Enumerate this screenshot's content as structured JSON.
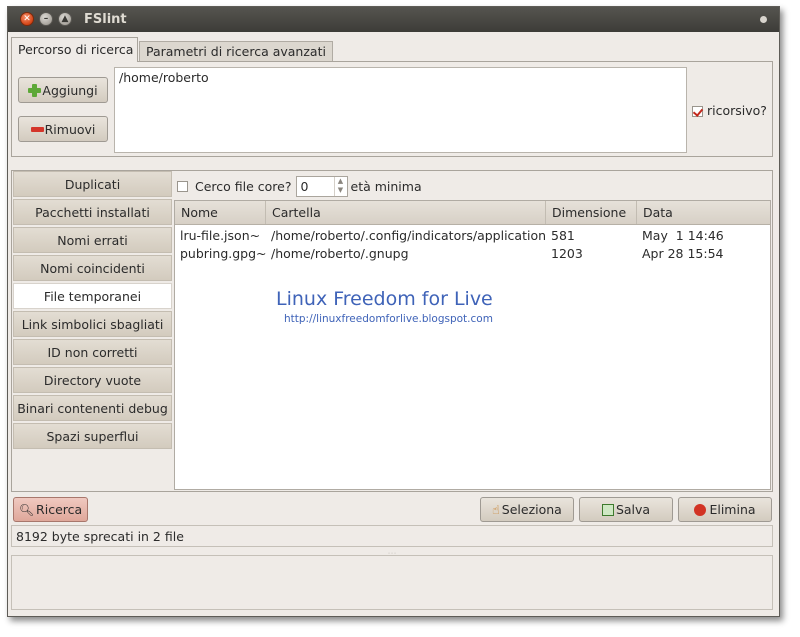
{
  "window": {
    "title": "FSlint"
  },
  "tabs": [
    {
      "label": "Percorso di ricerca"
    },
    {
      "label": "Parametri di ricerca avanzati"
    }
  ],
  "search_path": {
    "add_label": "Aggiungi",
    "remove_label": "Rimuovi",
    "paths": [
      "/home/roberto"
    ],
    "recursive_label": "ricorsivo?",
    "recursive_checked": true
  },
  "sidebar": {
    "items": [
      {
        "label": "Duplicati"
      },
      {
        "label": "Pacchetti installati"
      },
      {
        "label": "Nomi errati"
      },
      {
        "label": "Nomi coincidenti"
      },
      {
        "label": "File temporanei"
      },
      {
        "label": "Link simbolici sbagliati"
      },
      {
        "label": "ID non corretti"
      },
      {
        "label": "Directory vuote"
      },
      {
        "label": "Binari contenenti debug"
      },
      {
        "label": "Spazi superflui"
      }
    ],
    "selected_index": 4
  },
  "options": {
    "core_label": "Cerco file core?",
    "core_checked": false,
    "min_age_value": "0",
    "min_age_label": "età minima"
  },
  "table": {
    "columns": [
      "Nome",
      "Cartella",
      "Dimensione",
      "Data"
    ],
    "rows": [
      [
        "lru-file.json~",
        "/home/roberto/.config/indicators/application",
        "581",
        "May  1 14:46"
      ],
      [
        "pubring.gpg~",
        "/home/roberto/.gnupg",
        "1203",
        "Apr 28 15:54"
      ]
    ]
  },
  "watermark": {
    "title": "Linux Freedom for Live",
    "url": "http://linuxfreedomforlive.blogspot.com"
  },
  "actions": {
    "search_label": "Ricerca",
    "select_label": "Seleziona",
    "save_label": "Salva",
    "delete_label": "Elimina"
  },
  "status": {
    "text": "8192 byte sprecati in 2 file"
  },
  "icons": {
    "close": "close-icon",
    "minimize": "minimize-icon",
    "maximize": "maximize-icon",
    "add": "plus-icon",
    "remove": "minus-icon",
    "search": "magnifier-icon",
    "select": "hand-pointer-icon",
    "save": "save-icon",
    "delete": "stop-icon"
  },
  "colors": {
    "accent_checkbox": "#c2281c",
    "titlebar": "#3d3c38",
    "watermark": "#3f63b8"
  }
}
